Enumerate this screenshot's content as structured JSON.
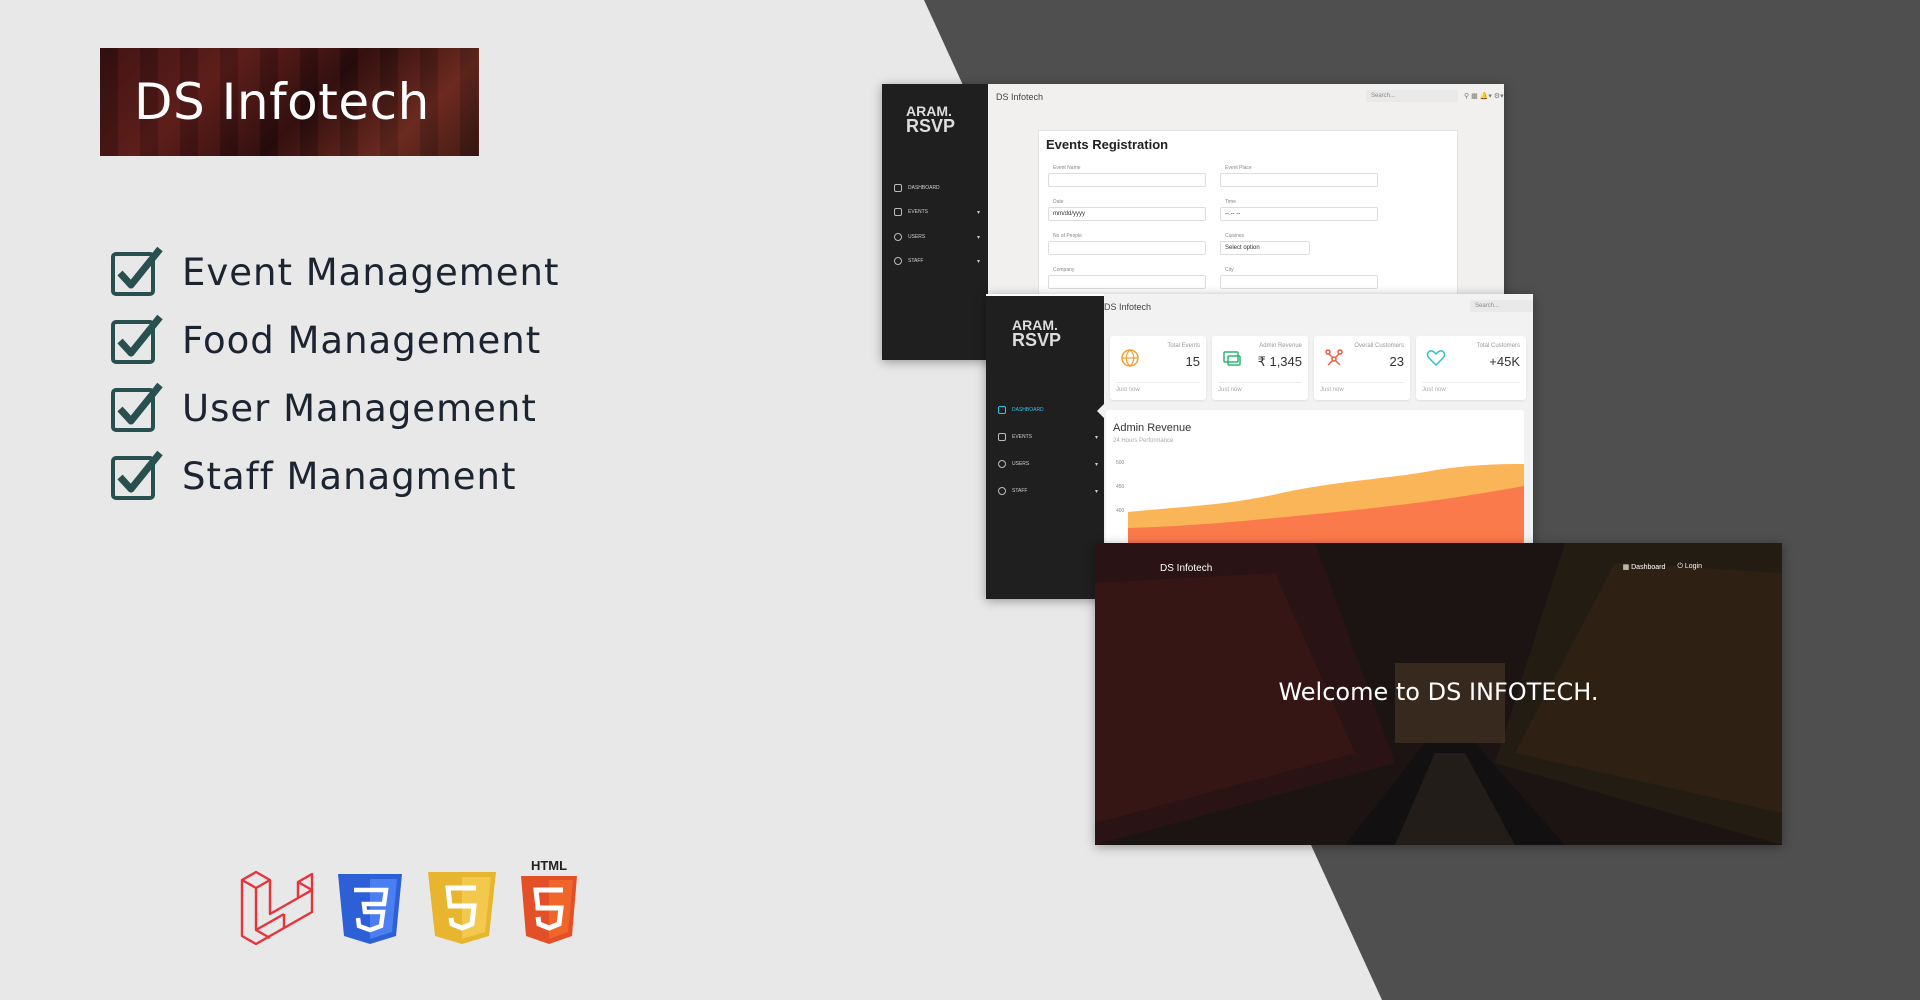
{
  "colors": {
    "background": "#e8e8e8",
    "dark_panel": "#4f4f4f",
    "check_color": "#27504f",
    "sidebar": "#1f1f1f"
  },
  "logo": {
    "text": "DS Infotech"
  },
  "features": [
    {
      "label": "Event Management",
      "icon": "checkbox-checked-icon"
    },
    {
      "label": "Food Management",
      "icon": "checkbox-checked-icon"
    },
    {
      "label": "User Management",
      "icon": "checkbox-checked-icon"
    },
    {
      "label": "Staff Managment",
      "icon": "checkbox-checked-icon"
    }
  ],
  "tech": [
    {
      "name": "laravel-icon"
    },
    {
      "name": "css3-icon"
    },
    {
      "name": "javascript-icon"
    },
    {
      "name": "html5-icon",
      "label": "HTML"
    }
  ],
  "screen1": {
    "title": "DS Infotech",
    "search_placeholder": "Search...",
    "sidebar_items": [
      "Dashboard",
      "Events",
      "Users",
      "Staff"
    ],
    "form": {
      "heading": "Events Registration",
      "fields": [
        {
          "label": "Event Name",
          "value": ""
        },
        {
          "label": "Event Place",
          "value": ""
        },
        {
          "label": "Date",
          "value": "mm/dd/yyyy"
        },
        {
          "label": "Time",
          "value": "--:-- --"
        },
        {
          "label": "No of People",
          "value": ""
        },
        {
          "label": "Cuisines",
          "value": "Select option"
        },
        {
          "label": "Company",
          "value": ""
        },
        {
          "label": "City",
          "value": ""
        }
      ]
    }
  },
  "screen2": {
    "title": "DS Infotech",
    "search_placeholder": "Search...",
    "sidebar_items": [
      "Dashboard",
      "Events",
      "Users",
      "Staff"
    ],
    "stats": [
      {
        "label": "Total Events",
        "value": "15",
        "footer": "Just now",
        "icon": "globe-icon",
        "color": "#f0a030"
      },
      {
        "label": "Admin Revenue",
        "value": "₹ 1,345",
        "footer": "Just now",
        "icon": "money-icon",
        "color": "#2bb673"
      },
      {
        "label": "Overall Customers",
        "value": "23",
        "footer": "Just now",
        "icon": "network-icon",
        "color": "#ef5b3a"
      },
      {
        "label": "Total Customers",
        "value": "+45K",
        "footer": "Just now",
        "icon": "heart-icon",
        "color": "#2ec4c4"
      }
    ],
    "revenue": {
      "title": "Admin Revenue",
      "subtitle": "24 Hours Performance",
      "ticks": [
        "500",
        "450",
        "400"
      ]
    }
  },
  "screen3": {
    "brand": "DS Infotech",
    "nav": [
      {
        "label": "Dashboard",
        "icon": "dashboard-icon"
      },
      {
        "label": "Login",
        "icon": "login-icon"
      }
    ],
    "welcome": "Welcome to DS INFOTECH."
  }
}
